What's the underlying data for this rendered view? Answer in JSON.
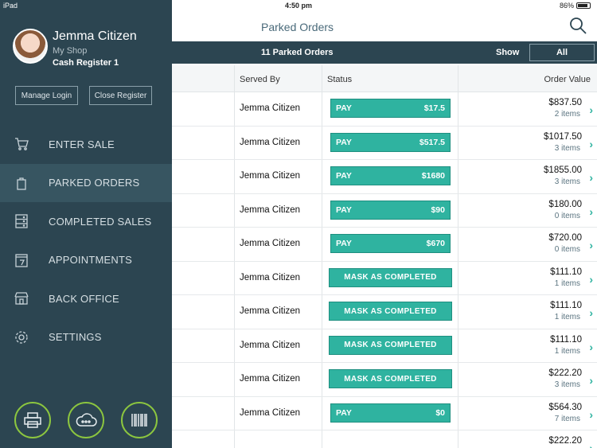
{
  "status_bar": {
    "carrier": "iPad",
    "time": "4:50 pm",
    "battery": "86%"
  },
  "profile": {
    "name": "Jemma Citizen",
    "shop": "My Shop",
    "register": "Cash Register 1"
  },
  "sidebar_buttons": {
    "manage": "Manage Login",
    "close": "Close Register"
  },
  "menu": [
    {
      "label": "ENTER SALE",
      "icon": "cart-icon"
    },
    {
      "label": "PARKED ORDERS",
      "icon": "bag-icon",
      "active": true
    },
    {
      "label": "COMPLETED SALES",
      "icon": "list-icon"
    },
    {
      "label": "APPOINTMENTS",
      "icon": "calendar-icon"
    },
    {
      "label": "BACK OFFICE",
      "icon": "shop-icon"
    },
    {
      "label": "SETTINGS",
      "icon": "gear-icon"
    }
  ],
  "bottom_icons": [
    "printer-icon",
    "cloud-icon",
    "barcode-icon"
  ],
  "header": {
    "title": "Parked Orders"
  },
  "orders_bar": {
    "count": "11 Parked Orders",
    "show": "Show",
    "filter": "All"
  },
  "columns": {
    "served_by": "Served By",
    "status": "Status",
    "order_value": "Order Value"
  },
  "rows": [
    {
      "served": "Jemma Citizen",
      "action": "PAY",
      "due": "$17.5",
      "amount": "$837.50",
      "items": "2 items"
    },
    {
      "served": "Jemma Citizen",
      "action": "PAY",
      "due": "$517.5",
      "amount": "$1017.50",
      "items": "3 items"
    },
    {
      "served": "Jemma Citizen",
      "action": "PAY",
      "due": "$1680",
      "amount": "$1855.00",
      "items": "3 items"
    },
    {
      "served": "Jemma Citizen",
      "action": "PAY",
      "due": "$90",
      "amount": "$180.00",
      "items": "0 items"
    },
    {
      "served": "Jemma Citizen",
      "action": "PAY",
      "due": "$670",
      "amount": "$720.00",
      "items": "0 items"
    },
    {
      "served": "Jemma Citizen",
      "action": "MASK AS COMPLETED",
      "due": "",
      "amount": "$111.10",
      "items": "1 items"
    },
    {
      "served": "Jemma Citizen",
      "action": "MASK AS COMPLETED",
      "due": "",
      "amount": "$111.10",
      "items": "1 items"
    },
    {
      "served": "Jemma Citizen",
      "action": "MASK AS COMPLETED",
      "due": "",
      "amount": "$111.10",
      "items": "1 items"
    },
    {
      "served": "Jemma Citizen",
      "action": "MASK AS COMPLETED",
      "due": "",
      "amount": "$222.20",
      "items": "3 items"
    },
    {
      "served": "Jemma Citizen",
      "action": "PAY",
      "due": "$0",
      "amount": "$564.30",
      "items": "7 items"
    },
    {
      "served": "",
      "action": "",
      "due": "",
      "amount": "$222.20",
      "items": ""
    }
  ],
  "colors": {
    "sidebar": "#2c4551",
    "accent": "#2fb3a0",
    "ring": "#8cc63f"
  }
}
